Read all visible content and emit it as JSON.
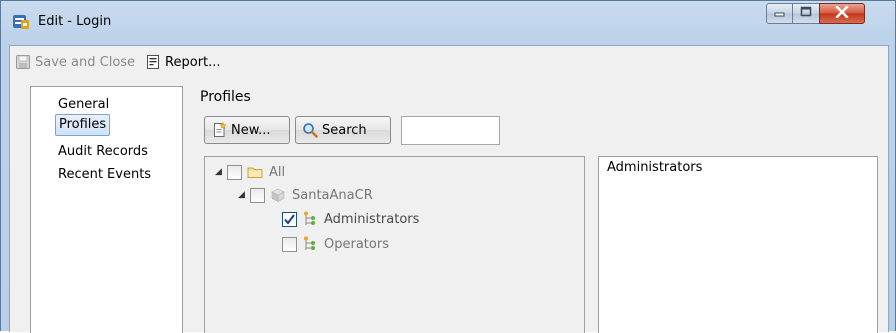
{
  "window": {
    "title": "Edit - Login"
  },
  "toolbar": {
    "save_label": "Save and Close",
    "report_label": "Report..."
  },
  "nav": {
    "items": [
      {
        "label": "General",
        "selected": false
      },
      {
        "label": "Profiles",
        "selected": true
      },
      {
        "label": "Audit Records",
        "selected": false
      },
      {
        "label": "Recent Events",
        "selected": false
      }
    ]
  },
  "profiles": {
    "heading": "Profiles",
    "new_button": "New...",
    "search_button": "Search",
    "search_value": "",
    "tree": [
      {
        "label": "All",
        "checked": false,
        "icon": "folder-icon"
      },
      {
        "label": "SantaAnaCR",
        "checked": false,
        "icon": "server-icon"
      },
      {
        "label": "Administrators",
        "checked": true,
        "icon": "profile-icon"
      },
      {
        "label": "Operators",
        "checked": false,
        "icon": "profile-icon"
      }
    ],
    "details_text": "Administrators"
  },
  "colors": {
    "title_bar": "#bcd2ea",
    "close_button": "#c3351a",
    "selection": "#cfe2f7"
  }
}
